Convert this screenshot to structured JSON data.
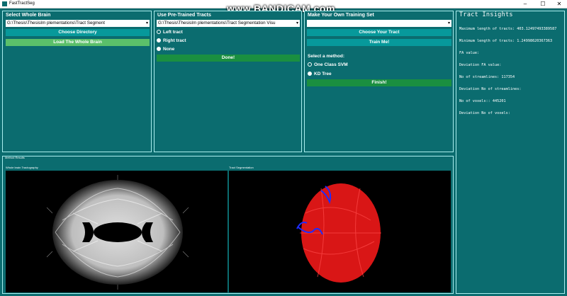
{
  "window": {
    "title": "FastTractSeg",
    "minimize": "–",
    "maximize": "☐",
    "close": "✕"
  },
  "watermark": "www.BANDICAM.com",
  "whole_brain": {
    "title": "Select Whole Brain",
    "path": "G:\\Thesis\\ThesisIm plementations\\Tract Segment",
    "choose_dir": "Choose Directory",
    "load": "Load The Whole Brain"
  },
  "pretrained": {
    "title": "Use Pre-Trained Tracts",
    "path": "G:\\Thesis\\ThesisIm plementations\\Tract Segmentation Visu",
    "options": [
      "Left tract",
      "Right tract",
      "None"
    ],
    "selected_index": 2,
    "done": "Done!"
  },
  "training": {
    "title": "Make Your Own Training Set",
    "path": "",
    "choose_tract": "Choose Your Tract",
    "train": "Train Me!",
    "method_label": "Select a method:",
    "methods": [
      "One Class SVM",
      "KD Tree"
    ],
    "selected_method": 1,
    "finish": "Finish!"
  },
  "insights": {
    "title": "Tract Insights",
    "lines": [
      "Maximum length of tracts: 403.12497493389587",
      "Minimum length of tracts: 1.24998620367363",
      "FA value:",
      "Deviation FA value:",
      "No of streamlines: 117354",
      "Deviation No of streamlines:",
      "No of voxels:: 445201",
      "Deviation No of voxels:"
    ]
  },
  "viewers": {
    "group_label": "Method Results",
    "left_label": "Whole brain Tractography",
    "right_label": "Tract Segmentation"
  },
  "colors": {
    "teal": "#0b6c6f",
    "button_blue": "#07999b",
    "button_green": "#1a8f40",
    "tract_red": "#ff1a1a",
    "tract_blue": "#1e2cff"
  }
}
